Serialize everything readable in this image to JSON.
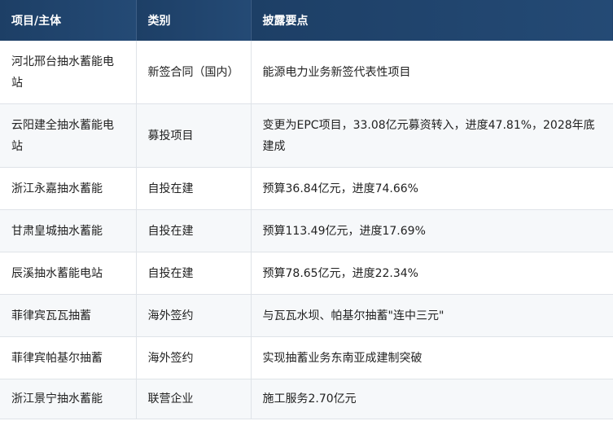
{
  "header": {
    "col1": "项目/主体",
    "col2": "类别",
    "col3": "披露要点"
  },
  "rows": [
    {
      "project": "河北邢台抽水蓄能电站",
      "category": "新签合同（国内）",
      "point": "能源电力业务新签代表性项目"
    },
    {
      "project": "云阳建全抽水蓄能电站",
      "category": "募投项目",
      "point": "变更为EPC项目，33.08亿元募资转入，进度47.81%，2028年底建成"
    },
    {
      "project": "浙江永嘉抽水蓄能",
      "category": "自投在建",
      "point": "预算36.84亿元，进度74.66%"
    },
    {
      "project": "甘肃皇城抽水蓄能",
      "category": "自投在建",
      "point": "预算113.49亿元，进度17.69%"
    },
    {
      "project": "辰溪抽水蓄能电站",
      "category": "自投在建",
      "point": "预算78.65亿元，进度22.34%"
    },
    {
      "project": "菲律宾瓦瓦抽蓄",
      "category": "海外签约",
      "point": "与瓦瓦水坝、帕基尔抽蓄\"连中三元\""
    },
    {
      "project": "菲律宾帕基尔抽蓄",
      "category": "海外签约",
      "point": "实现抽蓄业务东南亚成建制突破"
    },
    {
      "project": "浙江景宁抽水蓄能",
      "category": "联营企业",
      "point": "施工服务2.70亿元"
    }
  ]
}
